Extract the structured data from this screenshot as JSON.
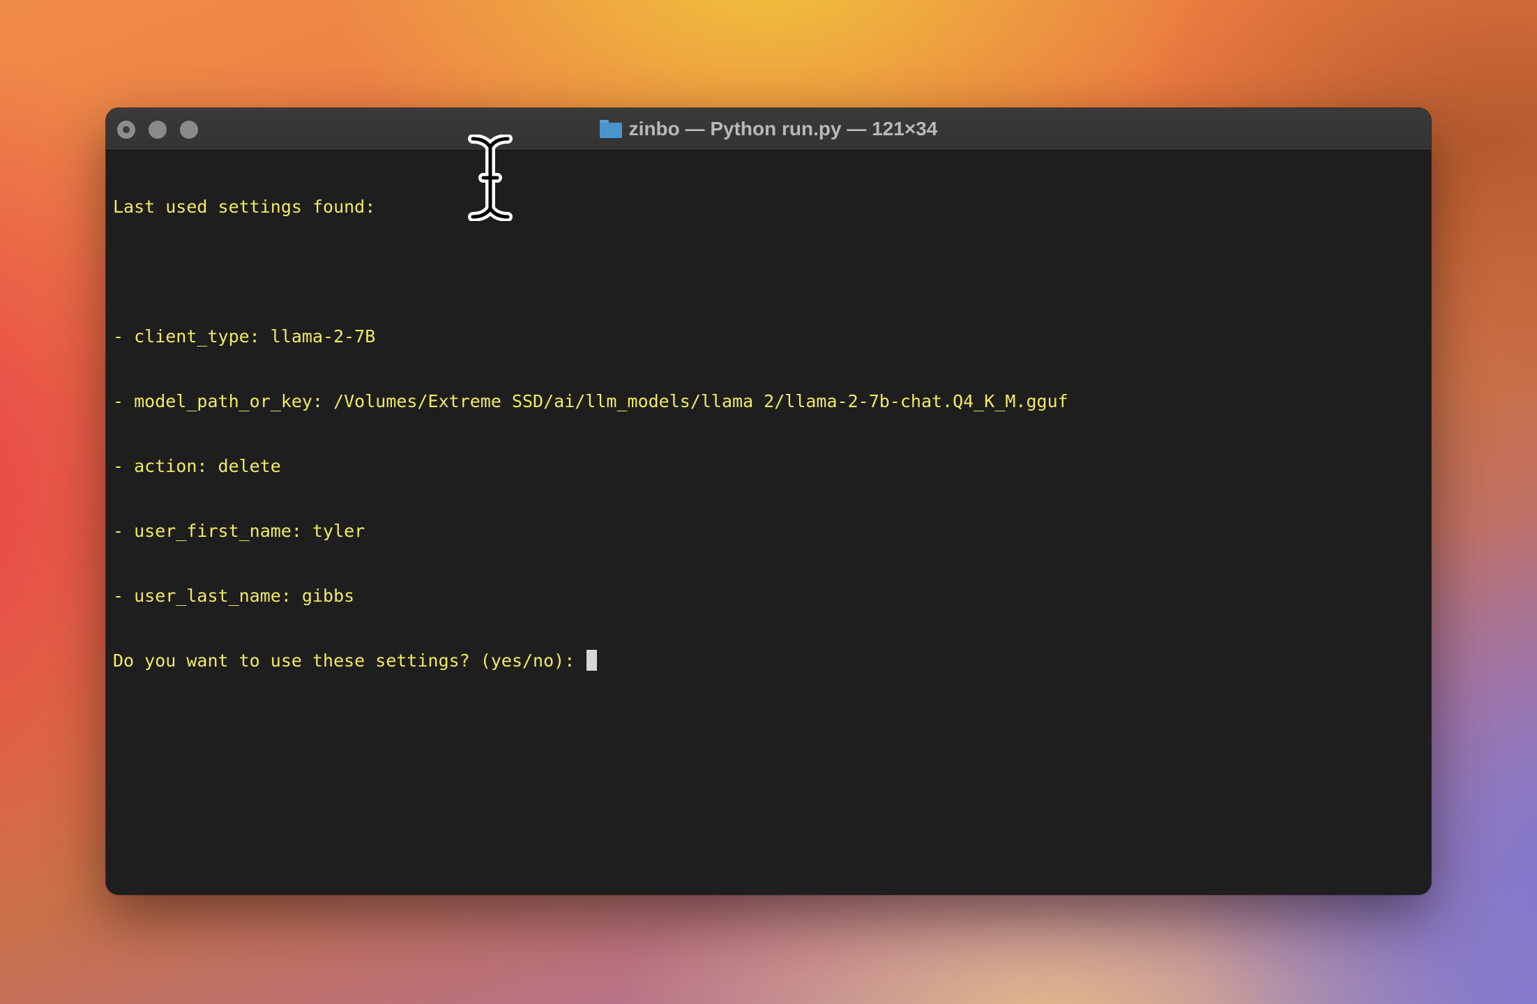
{
  "window": {
    "title": "zinbo — Python run.py — 121×34",
    "folder_icon": "folder-icon",
    "traffic_lights": [
      "close-button",
      "minimize-button",
      "zoom-button"
    ]
  },
  "terminal": {
    "lines": [
      "Last used settings found:",
      "",
      "- client_type: llama-2-7B",
      "- model_path_or_key: /Volumes/Extreme SSD/ai/llm_models/llama 2/llama-2-7b-chat.Q4_K_M.gguf",
      "- action: delete",
      "- user_first_name: tyler",
      "- user_last_name: gibbs"
    ],
    "prompt": "Do you want to use these settings? (yes/no): ",
    "text_color": "#f1ea63",
    "background_color": "#1e1e1e"
  },
  "pointer": {
    "icon": "ibeam-cursor-icon"
  }
}
